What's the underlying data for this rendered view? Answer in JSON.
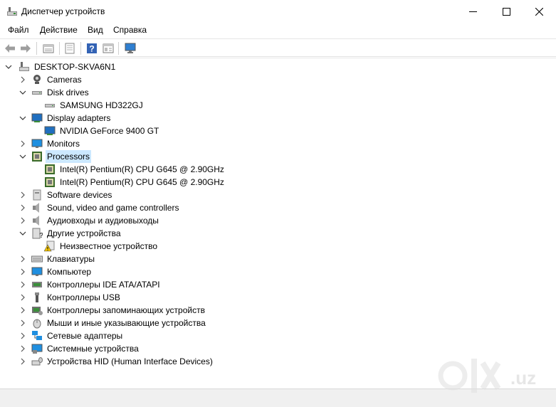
{
  "window": {
    "title": "Диспетчер устройств",
    "icons": {
      "app": "device-manager-icon",
      "minimize": "minimize-icon",
      "maximize": "maximize-icon",
      "close": "close-icon"
    }
  },
  "menu": {
    "file": "Файл",
    "action": "Действие",
    "view": "Вид",
    "help": "Справка"
  },
  "toolbar": {
    "buttons": [
      "back-icon",
      "forward-icon",
      "properties-icon",
      "update-driver-icon",
      "help-icon",
      "view-icon",
      "scan-hardware-icon"
    ]
  },
  "tree": {
    "root": "DESKTOP-SKVA6N1",
    "items": [
      {
        "label": "Cameras",
        "icon": "camera-icon",
        "expanded": false
      },
      {
        "label": "Disk drives",
        "icon": "disk-drive-icon",
        "expanded": true
      },
      {
        "label": "SAMSUNG HD322GJ",
        "icon": "disk-drive-icon",
        "child": true
      },
      {
        "label": "Display adapters",
        "icon": "display-adapter-icon",
        "expanded": true
      },
      {
        "label": "NVIDIA GeForce 9400 GT",
        "icon": "display-adapter-icon",
        "child": true
      },
      {
        "label": "Monitors",
        "icon": "monitor-icon",
        "expanded": false
      },
      {
        "label": "Processors",
        "icon": "processor-icon",
        "expanded": true,
        "selected": true
      },
      {
        "label": "Intel(R) Pentium(R) CPU G645 @ 2.90GHz",
        "icon": "processor-icon",
        "child": true
      },
      {
        "label": "Intel(R) Pentium(R) CPU G645 @ 2.90GHz",
        "icon": "processor-icon",
        "child": true
      },
      {
        "label": "Software devices",
        "icon": "software-device-icon",
        "expanded": false
      },
      {
        "label": "Sound, video and game controllers",
        "icon": "speaker-icon",
        "expanded": false
      },
      {
        "label": "Аудиовходы и аудиовыходы",
        "icon": "speaker-icon",
        "expanded": false
      },
      {
        "label": "Другие устройства",
        "icon": "other-device-icon",
        "expanded": true
      },
      {
        "label": "Неизвестное устройство",
        "icon": "warning-device-icon",
        "child": true
      },
      {
        "label": "Клавиатуры",
        "icon": "keyboard-icon",
        "expanded": false
      },
      {
        "label": "Компьютер",
        "icon": "computer-icon",
        "expanded": false
      },
      {
        "label": "Контроллеры IDE ATA/ATAPI",
        "icon": "ide-controller-icon",
        "expanded": false
      },
      {
        "label": "Контроллеры USB",
        "icon": "usb-icon",
        "expanded": false
      },
      {
        "label": "Контроллеры запоминающих устройств",
        "icon": "storage-controller-icon",
        "expanded": false
      },
      {
        "label": "Мыши и иные указывающие устройства",
        "icon": "mouse-icon",
        "expanded": false
      },
      {
        "label": "Сетевые адаптеры",
        "icon": "network-adapter-icon",
        "expanded": false
      },
      {
        "label": "Системные устройства",
        "icon": "system-device-icon",
        "expanded": false
      },
      {
        "label": "Устройства HID (Human Interface Devices)",
        "icon": "hid-icon",
        "expanded": false
      }
    ]
  },
  "watermark": {
    "text": ".uz",
    "logo": "olx-logo"
  }
}
